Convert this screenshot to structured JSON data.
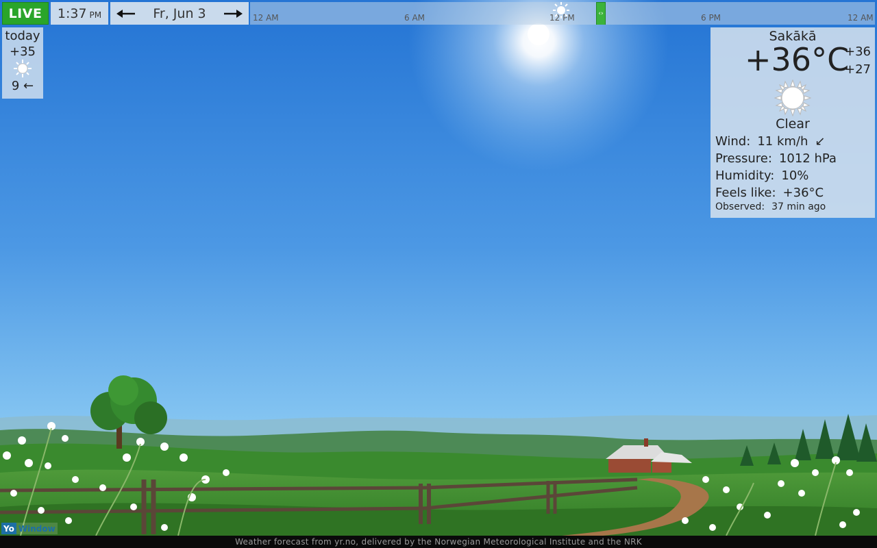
{
  "topbar": {
    "live_label": "LIVE",
    "time": "1:37",
    "time_ampm": "PM",
    "date": "Fr, Jun 3",
    "timeline_ticks": [
      "12 AM",
      "6 AM",
      "12 PM",
      "6 PM",
      "12 AM"
    ]
  },
  "today": {
    "label": "today",
    "high": "+35",
    "icon": "sun-icon",
    "wind": "9 ←"
  },
  "current": {
    "location": "Sakākā",
    "temperature": "+36°C",
    "high": "+36",
    "low": "+27",
    "condition": "Clear",
    "icon": "sun-icon",
    "wind_label": "Wind:",
    "wind_value": "11 km/h",
    "wind_arrow": "↙",
    "pressure_label": "Pressure:",
    "pressure_value": "1012 hPa",
    "humidity_label": "Humidity:",
    "humidity_value": "10%",
    "feels_label": "Feels like:",
    "feels_value": "+36°C",
    "observed_label": "Observed:",
    "observed_value": "37 min ago"
  },
  "footer": {
    "text": "Weather forecast from yr.no, delivered by the Norwegian Meteorological Institute and the NRK"
  },
  "brand": {
    "part1": "Yo",
    "part2": "Window"
  },
  "colors": {
    "live_green": "#2aa52a",
    "sky_top": "#2a7ed8",
    "sky_bottom": "#84c6f2",
    "grass": "#3f8f2c"
  }
}
